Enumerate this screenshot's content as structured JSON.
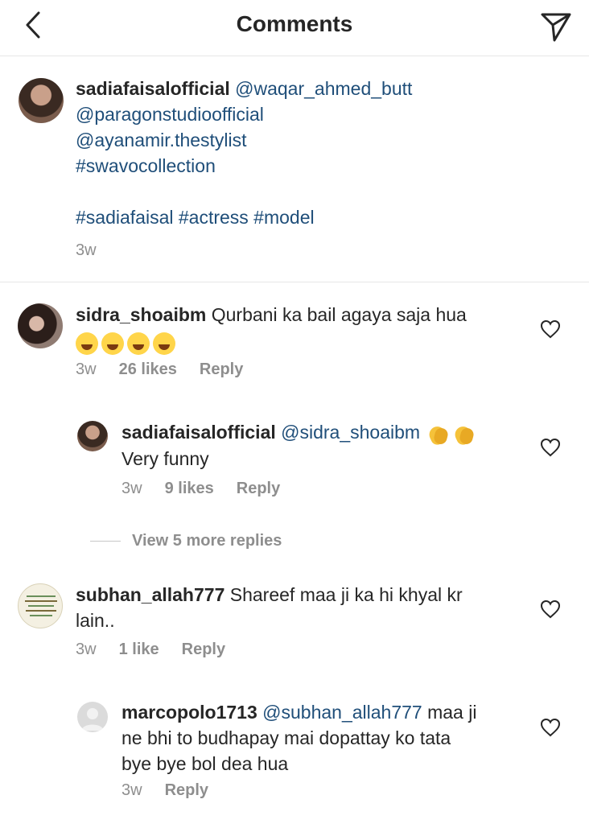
{
  "header": {
    "title": "Comments",
    "back_icon": "chevron-left-icon",
    "send_icon": "send-icon"
  },
  "caption": {
    "username": "sadiafaisalofficial",
    "lines": [
      "@waqar_ahmed_butt",
      "@paragonstudioofficial",
      "@ayanamir.thestylist",
      "#swavocollection",
      "#sadiafaisal #actress #model"
    ],
    "time": "3w"
  },
  "comments": [
    {
      "username": "sidra_shoaibm",
      "text": "Qurbani ka bail agaya saja hua",
      "emoji": "rolling-on-floor-laughing x4",
      "time": "3w",
      "likes": "26 likes",
      "reply": "Reply",
      "replies": [
        {
          "username": "sadiafaisalofficial",
          "mention": "@sidra_shoaibm",
          "emoji": "clapping-hands x2",
          "text": "Very funny",
          "time": "3w",
          "likes": "9 likes",
          "reply": "Reply"
        }
      ],
      "view_more": "View 5 more replies"
    },
    {
      "username": "subhan_allah777",
      "text_line1": "Shareef maa ji ka hi khyal kr",
      "text_line2": "lain..",
      "time": "3w",
      "likes": "1 like",
      "reply": "Reply",
      "replies": [
        {
          "username": "marcopolo1713",
          "mention": "@subhan_allah777",
          "text_line1": "maa ji",
          "text_line2": "ne bhi to budhapay mai dopattay ko tata",
          "text_line3": "bye bye bol dea hua",
          "time": "3w",
          "reply": "Reply"
        }
      ]
    }
  ],
  "colors": {
    "link": "#1f4e79",
    "meta": "#8e8e8e",
    "text": "#262626",
    "divider": "#e6e6e6"
  }
}
